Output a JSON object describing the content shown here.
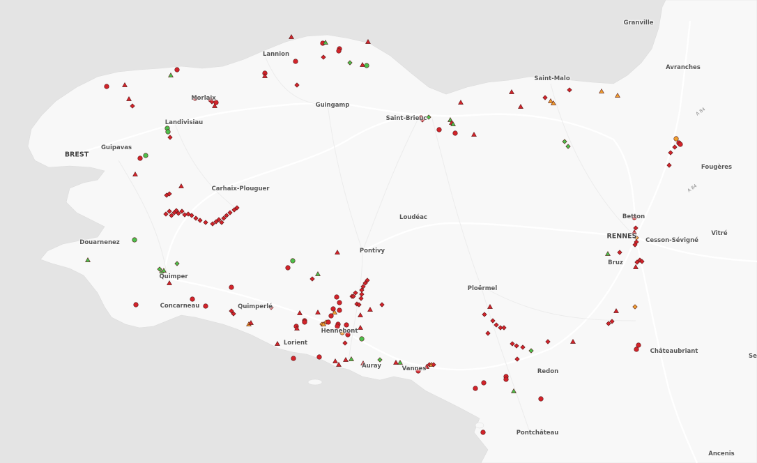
{
  "cities": [
    {
      "name": "Granville"
    },
    {
      "name": "Lannion"
    },
    {
      "name": "Avranches"
    },
    {
      "name": "Saint-Malo"
    },
    {
      "name": "Morlaix"
    },
    {
      "name": "Guingamp"
    },
    {
      "name": "Landivisiau"
    },
    {
      "name": "Saint-Brieuc"
    },
    {
      "name": "Guipavas"
    },
    {
      "name": "BREST"
    },
    {
      "name": "Fougères"
    },
    {
      "name": "Carhaix-Plouguer"
    },
    {
      "name": "Betton"
    },
    {
      "name": "Loudéac"
    },
    {
      "name": "Vitré"
    },
    {
      "name": "RENNES"
    },
    {
      "name": "Cesson-Sévigné"
    },
    {
      "name": "Douarnenez"
    },
    {
      "name": "Pontivy"
    },
    {
      "name": "Bruz"
    },
    {
      "name": "Quimper"
    },
    {
      "name": "Ploërmel"
    },
    {
      "name": "Concarneau"
    },
    {
      "name": "Quimperlé"
    },
    {
      "name": "Hennebont"
    },
    {
      "name": "Lorient"
    },
    {
      "name": "Châteaubriant"
    },
    {
      "name": "Redon"
    },
    {
      "name": "Auray"
    },
    {
      "name": "Vannes"
    },
    {
      "name": "Pontchâteau"
    },
    {
      "name": "Ancenis"
    },
    {
      "name": "Se"
    }
  ],
  "road_labels": [
    "A 84",
    "A 84"
  ],
  "colors": {
    "sea": "#e4e4e4",
    "land": "#f8f8f8",
    "red": "#d2232a",
    "green": "#4cbf4c",
    "orange": "#f0a030"
  },
  "marker_types": [
    "circle",
    "diamond",
    "triangle"
  ]
}
